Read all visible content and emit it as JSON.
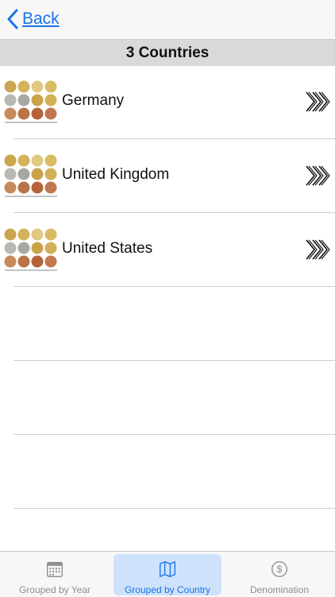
{
  "nav": {
    "back_label": "Back"
  },
  "header": {
    "title": "3 Countries"
  },
  "countries": [
    {
      "name": "Germany"
    },
    {
      "name": "United Kingdom"
    },
    {
      "name": "United States"
    }
  ],
  "tabs": [
    {
      "label": "Grouped by Year",
      "icon": "calendar-icon"
    },
    {
      "label": "Grouped by Country",
      "icon": "map-icon"
    },
    {
      "label": "Denomination",
      "icon": "dollar-icon"
    }
  ],
  "colors": {
    "accent": "#1a73e8",
    "header_bg": "#d9d9d9",
    "tab_active_bg": "#cfe2fb"
  }
}
